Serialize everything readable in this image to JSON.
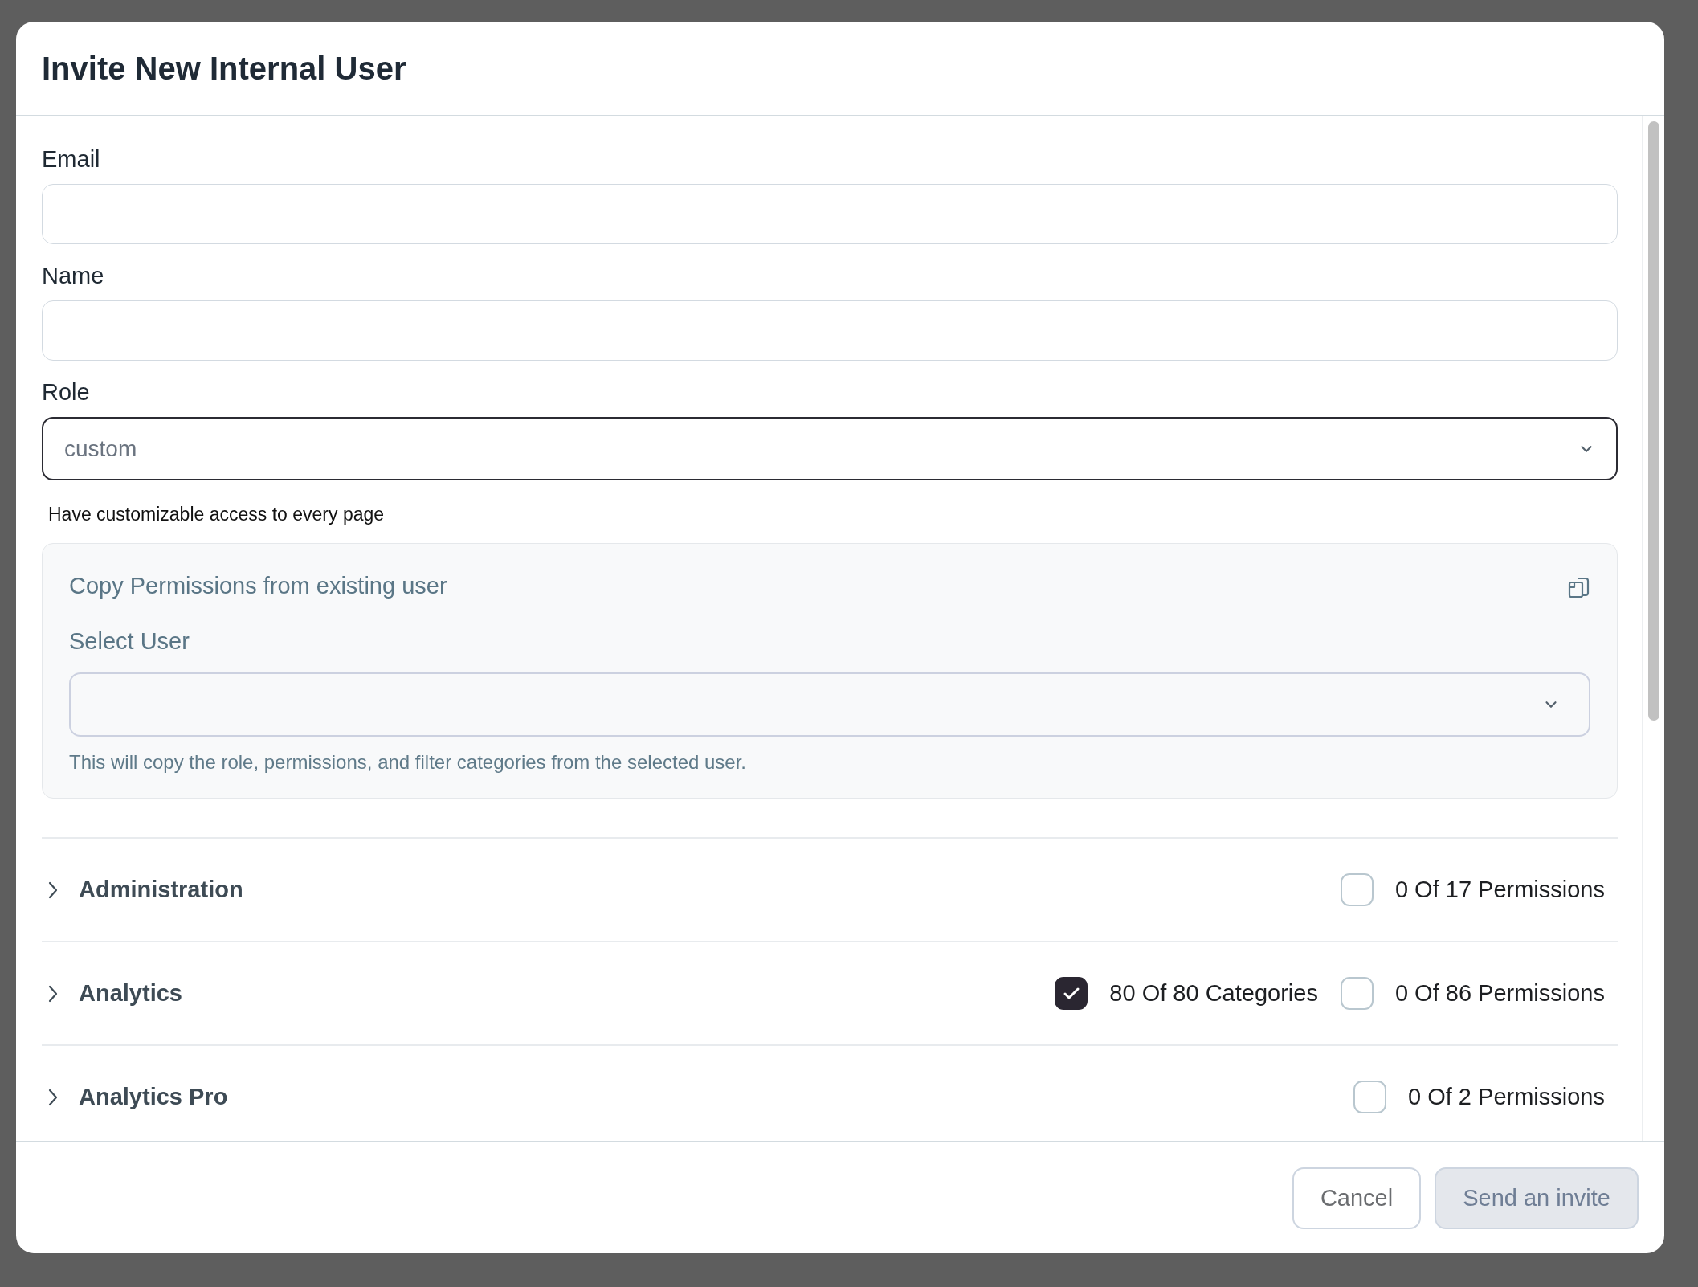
{
  "dialog": {
    "title": "Invite New Internal User"
  },
  "fields": [
    {
      "kind": "text",
      "label": "Email",
      "focused": false
    },
    {
      "kind": "text",
      "label": "Name",
      "focused": false
    },
    {
      "kind": "select",
      "label": "Role",
      "value": "custom",
      "focused": true,
      "hint": "Have customizable access to every page"
    }
  ],
  "copy_panel": {
    "title": "Copy Permissions from existing user",
    "field_label": "Select User",
    "note": "This will copy the role, permissions, and filter categories from the selected user."
  },
  "permission_groups": [
    {
      "name": "Administration",
      "expanded": false,
      "counters": [
        {
          "text": "0 Of 17 Permissions",
          "checked": false
        }
      ]
    },
    {
      "name": "Analytics",
      "expanded": false,
      "counters": [
        {
          "text": "80 Of 80 Categories",
          "checked": true
        },
        {
          "text": "0 Of 86 Permissions",
          "checked": false
        }
      ]
    },
    {
      "name": "Analytics Pro",
      "expanded": false,
      "counters": [
        {
          "text": "0 Of 2 Permissions",
          "checked": false
        }
      ]
    }
  ],
  "buttons": [
    {
      "label": "Cancel",
      "kind": "secondary",
      "disabled": false
    },
    {
      "label": "Send an invite",
      "kind": "primary",
      "disabled": true
    }
  ]
}
